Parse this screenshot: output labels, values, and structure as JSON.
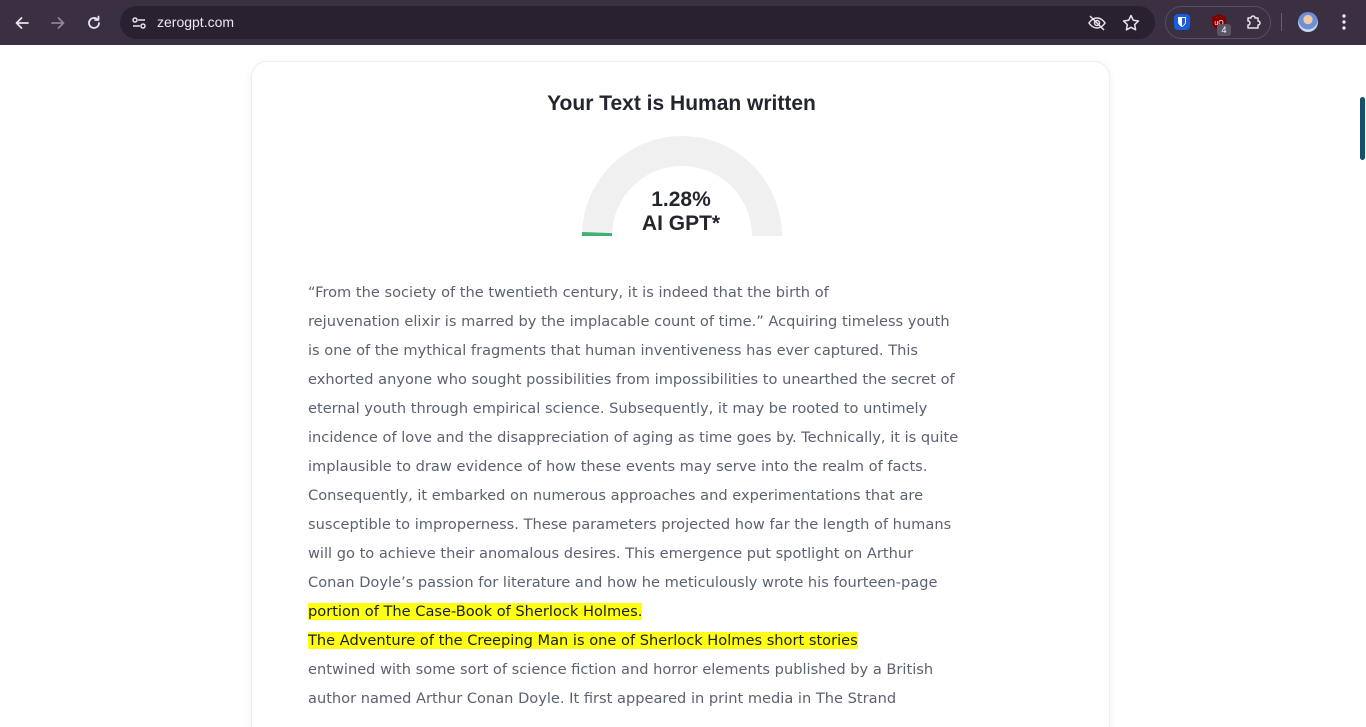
{
  "browser": {
    "url": "zerogpt.com",
    "icons": [
      "back-icon",
      "forward-icon",
      "reload-icon",
      "site-info-icon",
      "tracking-hidden-icon",
      "bookmark-star-icon",
      "bitwarden-extension-icon",
      "ublock-extension-icon",
      "extensions-puzzle-icon",
      "profile-avatar",
      "menu-kebab-icon"
    ],
    "ublock_badge": "4"
  },
  "result": {
    "title": "Your Text is Human written",
    "gauge": {
      "percent_value": 1.28,
      "percent_text": "1.28%",
      "label": "AI GPT*",
      "track_color": "#f0f0f0",
      "fill_color": "#3cb371"
    }
  },
  "analyzed_text": {
    "lines": [
      {
        "text": "“From the society of the twentieth century, it is indeed that the birth of",
        "highlighted": false
      },
      {
        "text": "rejuvenation elixir is marred by the implacable count of time.” Acquiring timeless youth",
        "highlighted": false
      },
      {
        "text": "is one of the mythical fragments that human inventiveness has ever captured. This",
        "highlighted": false
      },
      {
        "text": "exhorted anyone who sought possibilities from impossibilities to unearthed the secret of",
        "highlighted": false
      },
      {
        "text": "eternal youth through empirical science. Subsequently, it may be rooted to untimely",
        "highlighted": false
      },
      {
        "text": "incidence of love and the disappreciation of aging as time goes by. Technically, it is quite",
        "highlighted": false
      },
      {
        "text": "implausible to draw evidence of how these events may serve into the realm of facts.",
        "highlighted": false
      },
      {
        "text": "Consequently, it embarked on numerous approaches and experimentations that are",
        "highlighted": false
      },
      {
        "text": "susceptible to improperness. These parameters projected how far the length of humans",
        "highlighted": false
      },
      {
        "text": "will go to achieve their anomalous desires. This emergence put spotlight on Arthur",
        "highlighted": false
      },
      {
        "text": "Conan Doyle’s passion for literature and how he meticulously wrote his fourteen-page",
        "highlighted": false
      },
      {
        "text": "portion of The Case-Book of Sherlock Holmes.",
        "highlighted": true
      },
      {
        "text": "The Adventure of the Creeping Man is one of Sherlock Holmes short stories",
        "highlighted": true
      },
      {
        "text": "entwined with some sort of science fiction and horror elements published by a British",
        "highlighted": false
      },
      {
        "text": "author named Arthur Conan Doyle. It first appeared in print media in The Strand",
        "highlighted": false
      }
    ],
    "highlight_color": "#ffff14"
  }
}
